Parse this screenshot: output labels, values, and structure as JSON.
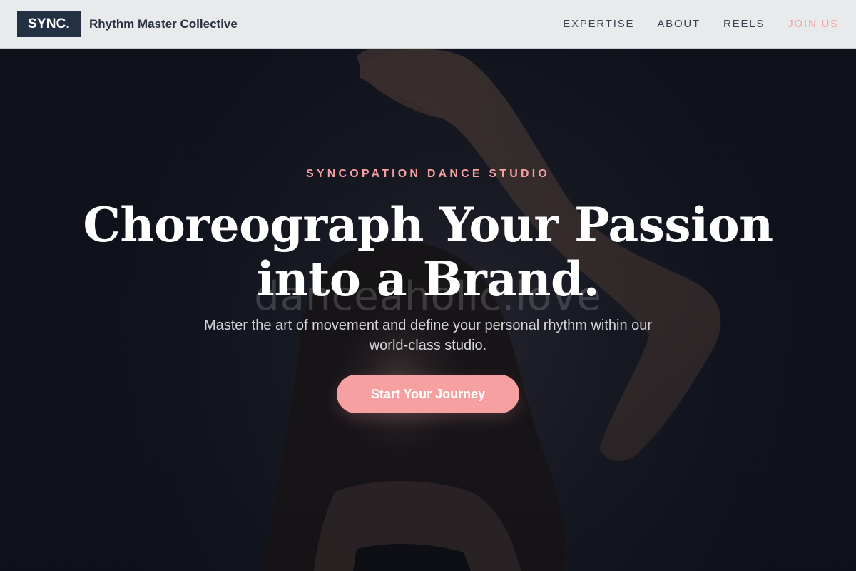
{
  "header": {
    "logo": "SYNC.",
    "brand_name": "Rhythm Master Collective",
    "nav": [
      {
        "label": "EXPERTISE"
      },
      {
        "label": "ABOUT"
      },
      {
        "label": "REELS"
      },
      {
        "label": "JOIN US"
      }
    ]
  },
  "hero": {
    "eyebrow": "SYNCOPATION DANCE STUDIO",
    "headline_line1": "Choreograph Your Passion",
    "headline_line2": "into a Brand.",
    "watermark": "danceaholic.love",
    "subtext": "Master the art of movement and define your personal rhythm within our world-class studio.",
    "cta_label": "Start Your Journey",
    "background_image": "dancer-portrait-photo"
  },
  "colors": {
    "accent": "#f7a0a2",
    "logo_bg": "#243044",
    "header_bg": "#e9eaeb",
    "hero_bg": "#141722"
  }
}
